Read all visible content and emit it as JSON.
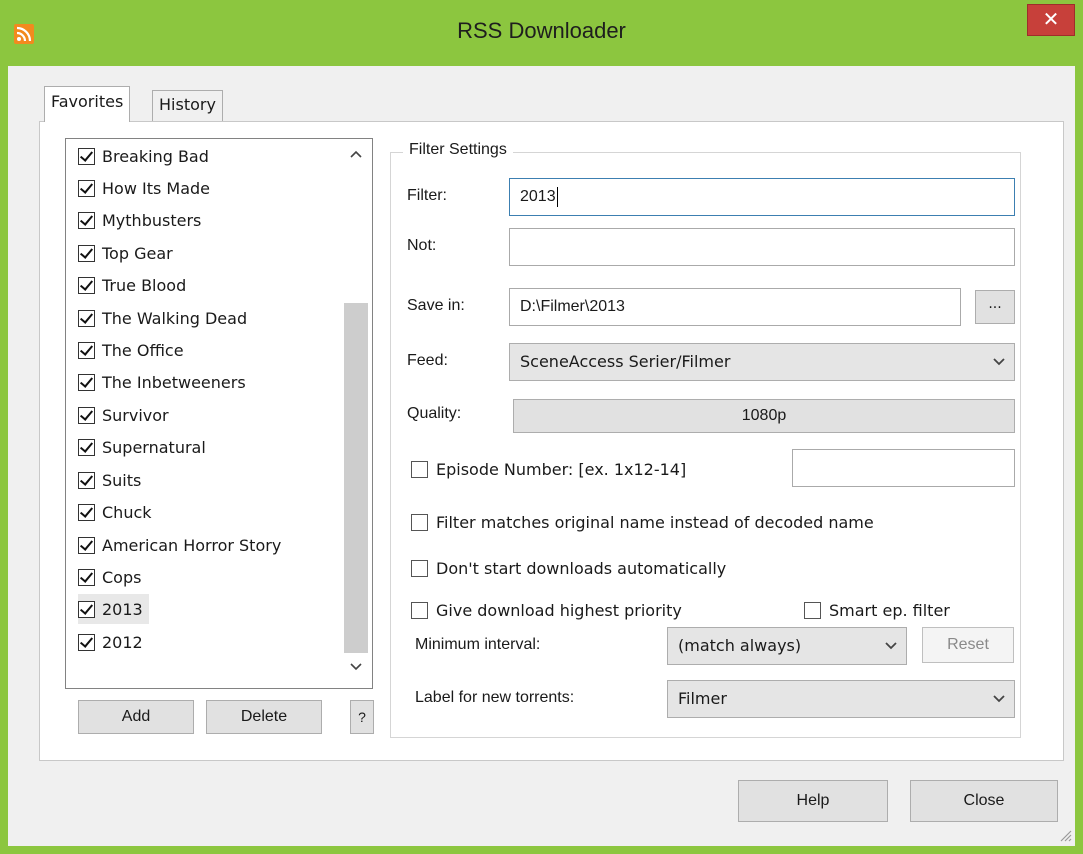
{
  "window": {
    "title": "RSS Downloader",
    "close_glyph": "✕",
    "accent_color": "#8cc63f",
    "close_color": "#c7403a",
    "app_icon": "rss-feed-icon"
  },
  "tabs": [
    {
      "label": "Favorites",
      "active": true
    },
    {
      "label": "History",
      "active": false
    }
  ],
  "favorites": {
    "items": [
      {
        "label": "Breaking Bad",
        "checked": true
      },
      {
        "label": "How Its Made",
        "checked": true
      },
      {
        "label": "Mythbusters",
        "checked": true
      },
      {
        "label": "Top Gear",
        "checked": true
      },
      {
        "label": "True Blood",
        "checked": true
      },
      {
        "label": "The Walking Dead",
        "checked": true
      },
      {
        "label": "The Office",
        "checked": true
      },
      {
        "label": "The Inbetweeners",
        "checked": true
      },
      {
        "label": "Survivor",
        "checked": true
      },
      {
        "label": "Supernatural",
        "checked": true
      },
      {
        "label": "Suits",
        "checked": true
      },
      {
        "label": "Chuck",
        "checked": true
      },
      {
        "label": "American Horror Story",
        "checked": true
      },
      {
        "label": "Cops",
        "checked": true
      },
      {
        "label": "2013",
        "checked": true,
        "selected": true
      },
      {
        "label": "2012",
        "checked": true
      }
    ],
    "add_label": "Add",
    "delete_label": "Delete",
    "help_label": "?"
  },
  "filter": {
    "legend": "Filter Settings",
    "filter_label": "Filter:",
    "filter_value": "2013",
    "not_label": "Not:",
    "not_value": "",
    "save_in_label": "Save in:",
    "save_in_value": "D:\\Filmer\\2013",
    "browse_label": "...",
    "feed_label": "Feed:",
    "feed_value": "SceneAccess Serier/Filmer",
    "quality_label": "Quality:",
    "quality_value": "1080p",
    "episode_label": "Episode Number: [ex. 1x12-14]",
    "episode_checked": false,
    "episode_value": "",
    "orig_name_label": "Filter matches original name instead of decoded name",
    "orig_name_checked": false,
    "no_autostart_label": "Don't start downloads automatically",
    "no_autostart_checked": false,
    "high_priority_label": "Give download highest priority",
    "high_priority_checked": false,
    "smart_ep_label": "Smart ep. filter",
    "smart_ep_checked": false,
    "min_interval_label": "Minimum interval:",
    "min_interval_value": "(match always)",
    "reset_label": "Reset",
    "torrent_label_label": "Label for new torrents:",
    "torrent_label_value": "Filmer"
  },
  "footer": {
    "help_label": "Help",
    "close_label": "Close"
  }
}
